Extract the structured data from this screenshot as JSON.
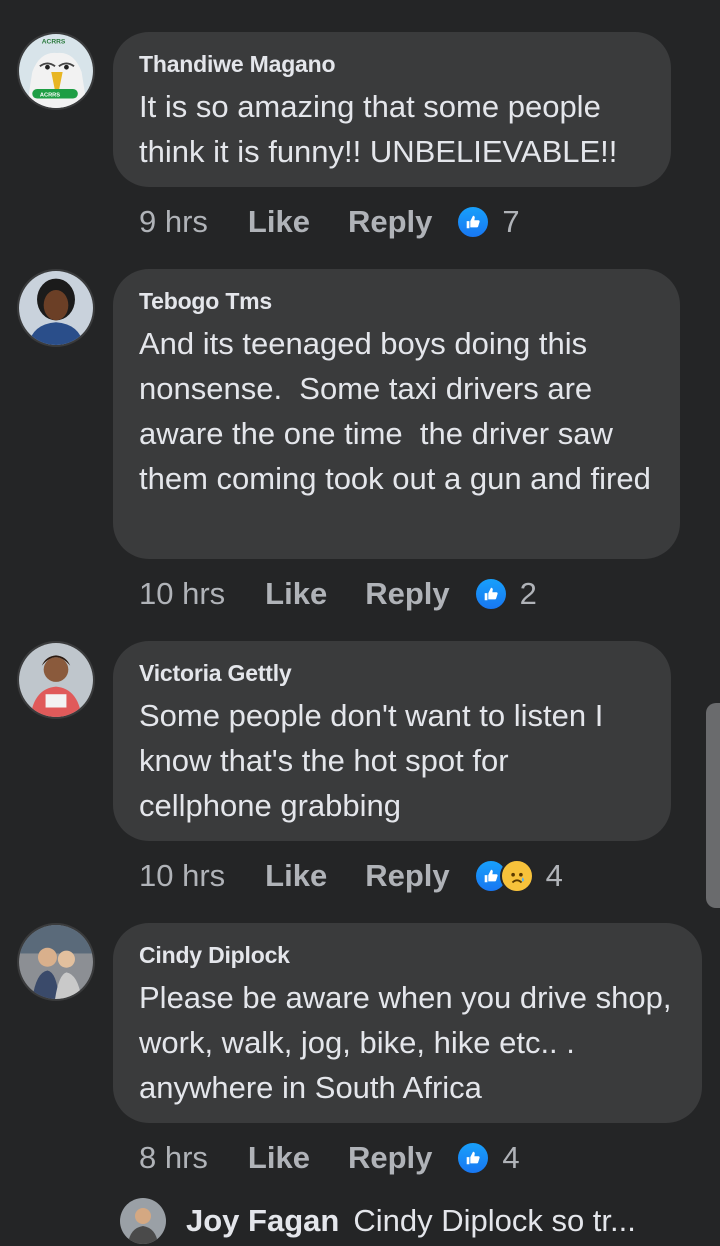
{
  "comments": [
    {
      "author": "Thandiwe Magano",
      "text": "It is so amazing that some people think it is funny!! UNBELIEVABLE!!",
      "time": "9 hrs",
      "like_label": "Like",
      "reply_label": "Reply",
      "reaction_count": "7",
      "reactions": [
        "like-icon"
      ],
      "avatar_text": "ACRRS",
      "avatar_badge": "ACRRS"
    },
    {
      "author": "Tebogo Tms",
      "text": "And its teenaged boys doing this nonsense.  Some taxi drivers are aware the one time  the driver saw them coming took out a gun and fired",
      "time": "10 hrs",
      "like_label": "Like",
      "reply_label": "Reply",
      "reaction_count": "2",
      "reactions": [
        "like-icon"
      ]
    },
    {
      "author": "Victoria Gettly",
      "text": "Some people don't want to listen I know that's the hot spot for cellphone grabbing",
      "time": "10 hrs",
      "like_label": "Like",
      "reply_label": "Reply",
      "reaction_count": "4",
      "reactions": [
        "like-icon",
        "sad-icon"
      ]
    },
    {
      "author": "Cindy Diplock",
      "text": "Please be aware when you drive shop, work, walk, jog, bike, hike etc.. . anywhere in South Africa",
      "time": "8 hrs",
      "like_label": "Like",
      "reply_label": "Reply",
      "reaction_count": "4",
      "reactions": [
        "like-icon"
      ]
    }
  ],
  "reply_preview": {
    "author": "Joy Fagan",
    "text": "Cindy Diplock so tr..."
  },
  "colors": {
    "background": "#242526",
    "bubble": "#3a3b3c",
    "primary_text": "#e4e6eb",
    "secondary_text": "#b0b3b8",
    "like_blue": "#1877f2",
    "sad_yellow": "#f7c23b"
  }
}
